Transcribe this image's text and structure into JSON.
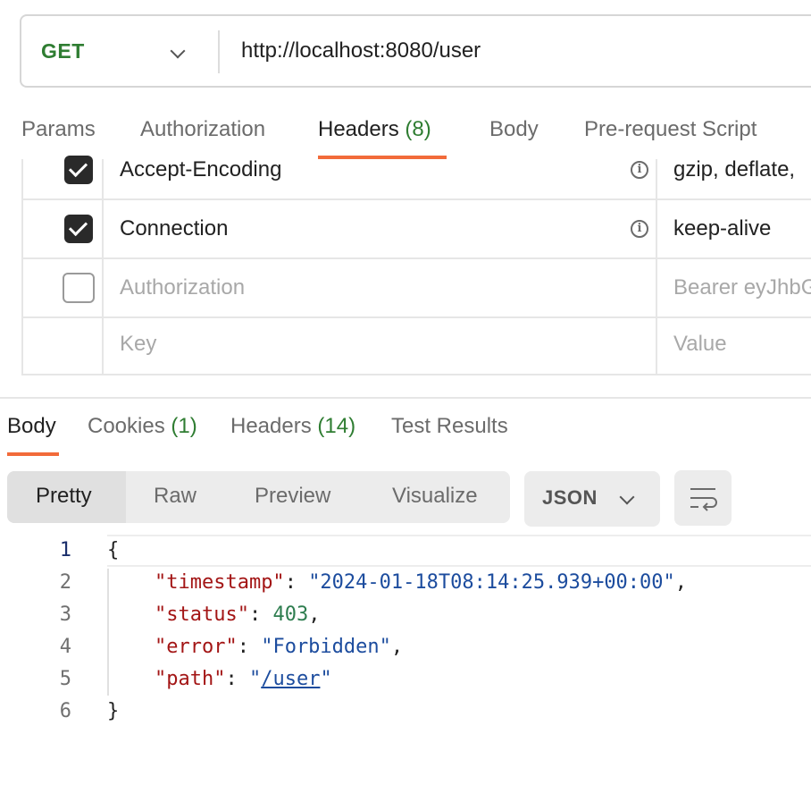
{
  "request": {
    "method": "GET",
    "url": "http://localhost:8080/user"
  },
  "request_tabs": {
    "params": "Params",
    "authorization": "Authorization",
    "headers": "Headers",
    "headers_count": "(8)",
    "body": "Body",
    "pre_request": "Pre-request Script"
  },
  "headers_table": {
    "rows": [
      {
        "key": "Accept-Encoding",
        "value": "gzip, deflate,",
        "checked": true
      },
      {
        "key": "Connection",
        "value": "keep-alive",
        "checked": true
      },
      {
        "key": "Authorization",
        "value": "Bearer eyJhbG",
        "checked": false
      }
    ],
    "key_placeholder": "Key",
    "value_placeholder": "Value",
    "info_glyph": "i"
  },
  "response_tabs": {
    "body": "Body",
    "cookies": "Cookies",
    "cookies_count": "(1)",
    "headers": "Headers",
    "headers_count": "(14)",
    "test_results": "Test Results"
  },
  "view_modes": {
    "pretty": "Pretty",
    "raw": "Raw",
    "preview": "Preview",
    "visualize": "Visualize"
  },
  "format": "JSON",
  "code": {
    "line_numbers": [
      "1",
      "2",
      "3",
      "4",
      "5",
      "6"
    ],
    "open_brace": "{",
    "close_brace": "}",
    "entries": [
      {
        "key": "\"timestamp\"",
        "value": "\"2024-01-18T08:14:25.939+00:00\""
      },
      {
        "key": "\"status\"",
        "value": "403"
      },
      {
        "key": "\"error\"",
        "value": "\"Forbidden\""
      },
      {
        "key": "\"path\"",
        "value_quote": "\"",
        "value_link": "/user"
      }
    ]
  },
  "colors": {
    "accent_underline": "#f26b3a",
    "method_green": "#2f7d32",
    "json_key": "#a31515",
    "json_string": "#1c4c9e",
    "json_number": "#2e7d4f"
  },
  "icons": [
    "chevron-down-icon",
    "checkbox-checked-icon",
    "checkbox-unchecked-icon",
    "info-icon",
    "wrap-lines-icon"
  ]
}
